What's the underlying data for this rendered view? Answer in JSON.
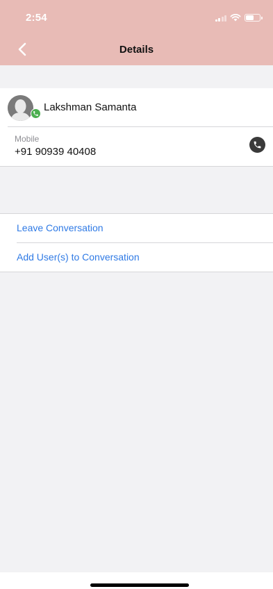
{
  "status_bar": {
    "time": "2:54"
  },
  "nav": {
    "title": "Details",
    "back_icon": "chevron-left-icon"
  },
  "contact": {
    "name": "Lakshman Samanta",
    "avatar_icon": "person-avatar-icon",
    "badge_icon": "whatsapp-badge-icon",
    "phone_label": "Mobile",
    "phone_number": "+91 90939 40408",
    "call_icon": "phone-icon"
  },
  "actions": {
    "leave": "Leave Conversation",
    "add_users": "Add User(s) to Conversation"
  },
  "colors": {
    "header": "#e8bbb6",
    "link": "#2f7ae5",
    "badge": "#4caf50",
    "background": "#f2f2f4"
  }
}
